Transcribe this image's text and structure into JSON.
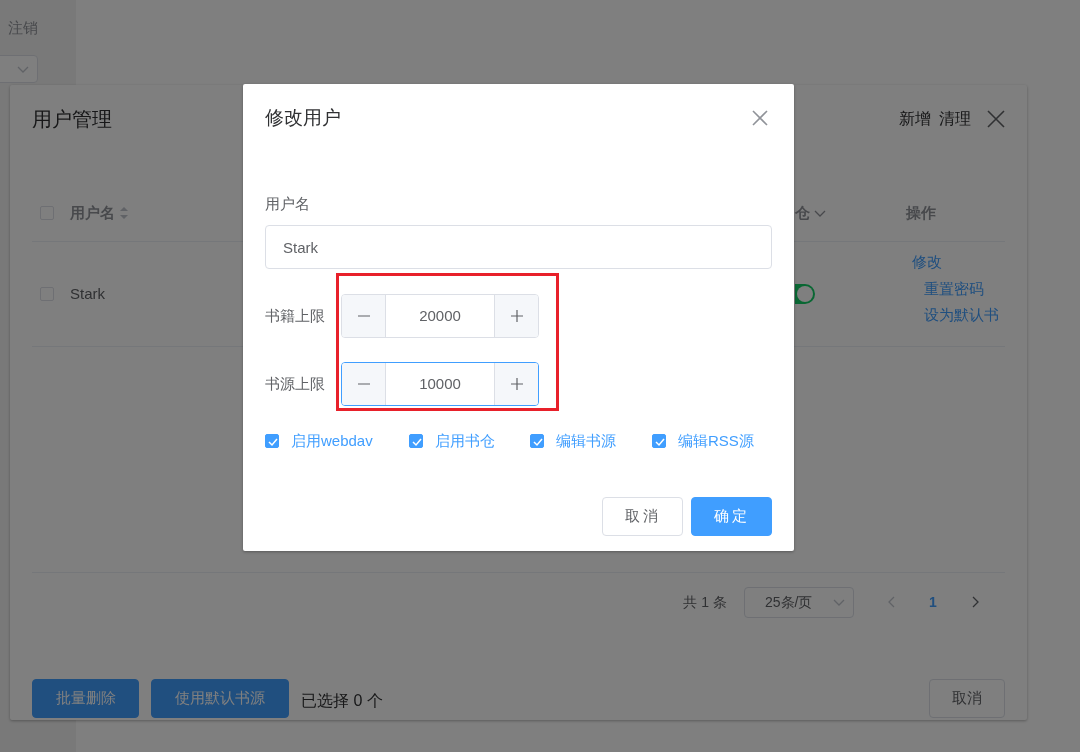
{
  "background": {
    "logout": "注销",
    "panel": {
      "title": "用户管理",
      "actions": [
        "新增",
        "清理"
      ],
      "table": {
        "header_checked": false,
        "columns": [
          {
            "label": "用户名",
            "kind": "sortable"
          },
          {
            "label": "仓",
            "kind": "filter"
          },
          {
            "label": "操作",
            "kind": "plain"
          }
        ],
        "rows": [
          {
            "selected": false,
            "username": "Stark",
            "enabled": true,
            "actions": [
              "修改",
              "重置密码",
              "设为默认书"
            ]
          }
        ]
      },
      "pagination": {
        "total": "共 1 条",
        "page_size": "25条/页",
        "pages": [
          {
            "label": "1",
            "selected": true
          }
        ]
      },
      "buttons": [
        {
          "label": "批量删除",
          "kind": "primary"
        },
        {
          "label": "使用默认书源",
          "kind": "primary"
        }
      ],
      "selection_text": "已选择 0 个",
      "cancel": "取消"
    }
  },
  "dialog": {
    "title": "修改用户",
    "username": {
      "label": "用户名",
      "value": "Stark"
    },
    "limits_highlighted": true,
    "limits": [
      {
        "label": "书籍上限",
        "value": "20000",
        "focused": false
      },
      {
        "label": "书源上限",
        "value": "10000",
        "focused": true
      }
    ],
    "permissions": [
      {
        "label": "启用webdav",
        "checked": true
      },
      {
        "label": "启用书仓",
        "checked": true
      },
      {
        "label": "编辑书源",
        "checked": true
      },
      {
        "label": "编辑RSS源",
        "checked": true
      }
    ],
    "buttons": [
      {
        "label": "取消",
        "kind": "default"
      },
      {
        "label": "确定",
        "kind": "primary"
      }
    ]
  }
}
